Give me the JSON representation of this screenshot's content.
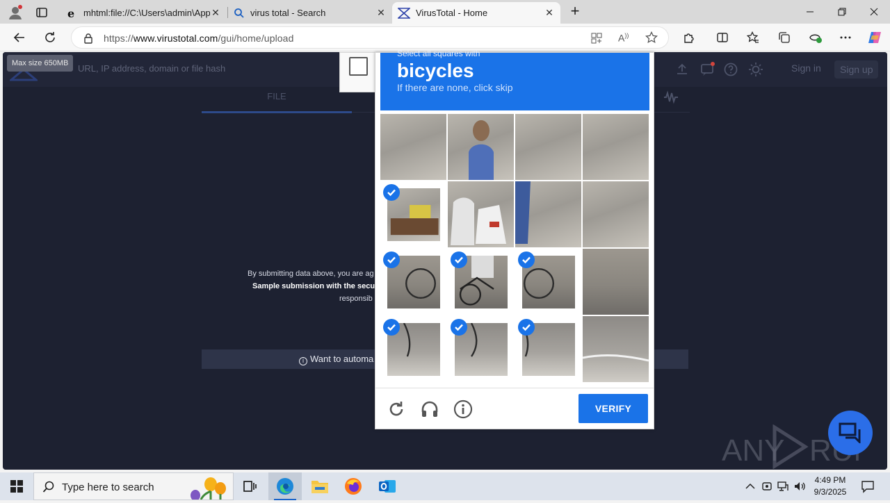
{
  "browser": {
    "tabs": [
      {
        "title": "mhtml:file://C:\\Users\\admin\\AppD",
        "icon": "ie-file-icon"
      },
      {
        "title": "virus total - Search",
        "icon": "search-icon"
      },
      {
        "title": "VirusTotal - Home",
        "icon": "virustotal-icon",
        "active": true
      }
    ],
    "url_prefix": "https://",
    "url_host": "www.virustotal.com",
    "url_path": "/gui/home/upload"
  },
  "virustotal": {
    "search_placeholder": "URL, IP address, domain or file hash",
    "max_size_tooltip": "Max size 650MB",
    "sign_in": "Sign in",
    "sign_up": "Sign up",
    "tab_file": "FILE",
    "terms_line1": "By submitting data above, you are ag",
    "terms_line2": "Sample submission with the secu",
    "terms_line3": "responsib",
    "automate_text": "Want to automa",
    "accent_color": "#2d4a8a"
  },
  "captcha": {
    "instruction_small": "Select all squares with",
    "target": "bicycles",
    "hint": "If there are none, click skip",
    "verify_label": "VERIFY",
    "accent_color": "#1a73e8",
    "selected_tiles": [
      4,
      8,
      9,
      10,
      12,
      13,
      14
    ],
    "tile_count": 16
  },
  "watermark": {
    "text": "ANY RUN"
  },
  "taskbar": {
    "search_placeholder": "Type here to search",
    "time": "4:49 PM",
    "date": "9/3/2025"
  }
}
